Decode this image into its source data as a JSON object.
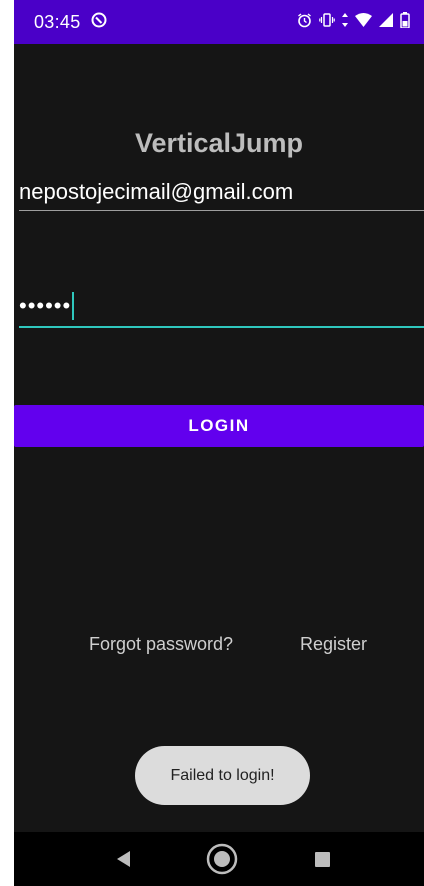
{
  "status_bar": {
    "time": "03:45",
    "icons": [
      "do-not-disturb-icon",
      "alarm-icon",
      "vibrate-icon",
      "data-arrows-icon",
      "wifi-icon",
      "cell-signal-icon",
      "battery-icon"
    ]
  },
  "app": {
    "title": "VerticalJump"
  },
  "login_form": {
    "email_value": "nepostojecimail@gmail.com",
    "password_masked": "••••••",
    "login_label": "LOGIN"
  },
  "links": {
    "forgot_password": "Forgot password?",
    "register": "Register"
  },
  "toast": {
    "message": "Failed to login!"
  },
  "nav_bar": {
    "buttons": [
      "back-icon",
      "home-icon",
      "recents-icon"
    ]
  },
  "colors": {
    "status_bar": "#4a00c8",
    "background": "#151515",
    "accent_button": "#6200ee",
    "focus_underline": "#2fc7bd"
  }
}
